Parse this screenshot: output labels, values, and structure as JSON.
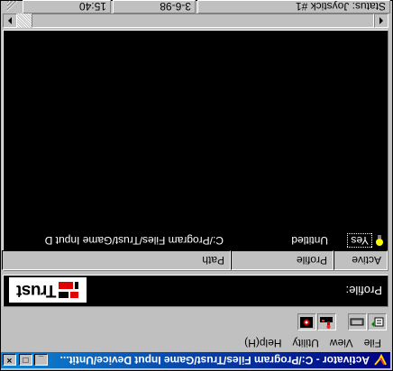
{
  "window": {
    "title": "Activator - C:/Program Files/Trust/Game Input Device/Untit...",
    "minimize_glyph": "_",
    "maximize_glyph": "□",
    "close_glyph": "×",
    "title_gradient": [
      "#000080",
      "#1084d0"
    ]
  },
  "menu": {
    "items": [
      "File",
      "View",
      "Utility",
      "Help(H)"
    ]
  },
  "toolbar": {
    "buttons": [
      {
        "icon": "add-profile-icon"
      },
      {
        "icon": "keyboard-icon"
      },
      {
        "icon": "joystick-red-icon"
      },
      {
        "icon": "camera-icon"
      }
    ]
  },
  "profile_panel": {
    "label": "Profile:",
    "logo_text": "Trust",
    "logo_mark_color": "#e00000"
  },
  "list": {
    "columns": [
      "Active",
      "Profile",
      "Path"
    ],
    "rows": [
      {
        "active": "Yes",
        "profile": "Untitled",
        "path": "C:/Program Files/Trust/Game Input D"
      }
    ],
    "background": "#000000",
    "text_color": "#ffffff"
  },
  "statusbar": {
    "status": "Status: Joystick #1",
    "date": "3-6-98",
    "time": "15:40"
  }
}
